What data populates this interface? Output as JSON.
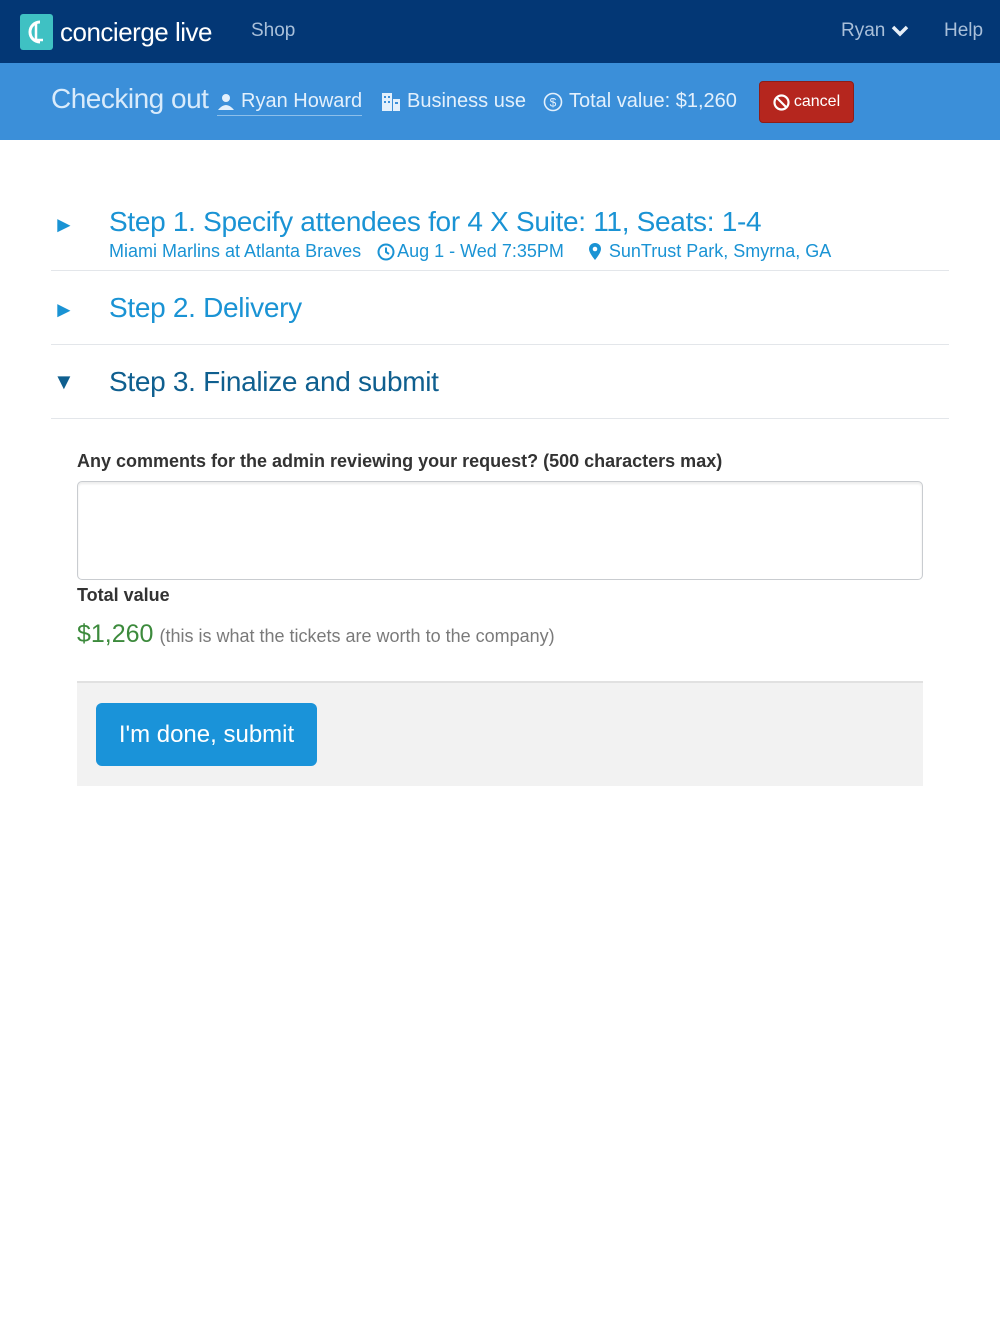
{
  "nav": {
    "brand": "concierge live",
    "shop": "Shop",
    "user": "Ryan",
    "help": "Help"
  },
  "checkout": {
    "title": "Checking out",
    "person": "Ryan Howard",
    "use": "Business use",
    "total": "Total value: $1,260",
    "cancel": "cancel"
  },
  "steps": [
    {
      "arrow": "►",
      "title": "Step 1. Specify attendees for 4 X Suite: 11, Seats: 1-4",
      "event": "Miami Marlins at Atlanta Braves",
      "time": "Aug 1 - Wed 7:35PM",
      "venue": "SunTrust Park, Smyrna, GA"
    },
    {
      "arrow": "►",
      "title": "Step 2. Delivery"
    },
    {
      "arrow": "▼",
      "title": "Step 3. Finalize and submit"
    }
  ],
  "form": {
    "comment_label": "Any comments for the admin reviewing your request? (500 characters max)",
    "comment_value": "",
    "total_label": "Total value",
    "total_amount": "$1,260",
    "total_note": "(this is what the tickets are worth to the company)",
    "submit": "I'm done, submit"
  },
  "colors": {
    "nav_bg": "#033775",
    "checkout_bg": "#3b8fd9",
    "step_blue": "#1a93d4",
    "cancel_red": "#b5261e",
    "submit_blue": "#1a93d9",
    "money_green": "#3c8a3c"
  }
}
